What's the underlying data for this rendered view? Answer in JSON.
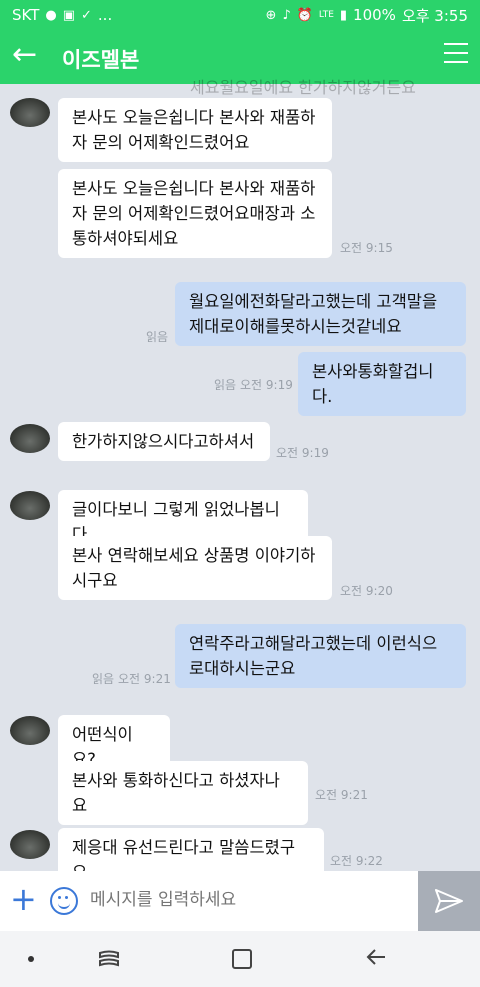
{
  "status": {
    "carrier": "SKT",
    "icons_left": [
      "talk-badge-icon",
      "image-icon",
      "v-icon"
    ],
    "more": "...",
    "battery": "100%",
    "time": "오후 3:55",
    "lte": "LTE"
  },
  "header": {
    "title": "이즈멜본"
  },
  "ghost_text": "세요월요일에요 한가하지않거든요",
  "messages": [
    {
      "dir": "in",
      "text": "본사도 오늘은쉽니다 본사와 재품하자 문의 어제확인드렸어요",
      "time": ""
    },
    {
      "dir": "in",
      "text": "본사도 오늘은쉽니다 본사와 재품하자 문의 어제확인드렸어요매장과 소통하셔야되세요",
      "time": "오전 9:15"
    },
    {
      "dir": "out",
      "text": "월요일에전화달라고했는데 고객말을제대로이해를못하시는것같네요",
      "time": "",
      "read": "읽음"
    },
    {
      "dir": "out",
      "text": "본사와통화할겁니다.",
      "time": "오전 9:19",
      "read": "읽음"
    },
    {
      "dir": "in",
      "text": "한가하지않으시다고하셔서",
      "time": "오전 9:19"
    },
    {
      "dir": "in",
      "text": "글이다보니 그렇게 읽었나봅니다",
      "time": ""
    },
    {
      "dir": "in",
      "text": "본사 연락해보세요 상품명 이야기하시구요",
      "time": "오전 9:20"
    },
    {
      "dir": "out",
      "text": "연락주라고해달라고했는데 이런식으로대하시는군요",
      "time": "오전 9:21",
      "read": "읽음"
    },
    {
      "dir": "in",
      "text": "어떤식이요?",
      "time": ""
    },
    {
      "dir": "in",
      "text": "본사와 통화하신다고 하셨자나요",
      "time": "오전 9:21"
    },
    {
      "dir": "in",
      "text": "제응대 유선드린다고 말씀드렸구요",
      "time": "오전 9:22"
    }
  ],
  "input": {
    "placeholder": "메시지를 입력하세요"
  }
}
